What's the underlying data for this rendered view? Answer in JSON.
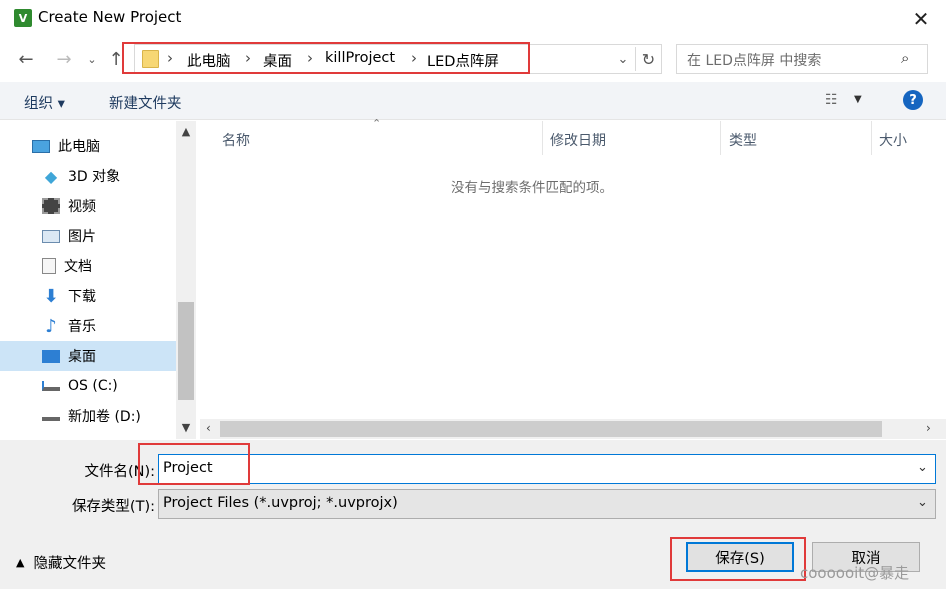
{
  "window": {
    "title": "Create New Project",
    "app_icon_glyph": "V",
    "close_glyph": "✕"
  },
  "nav": {
    "breadcrumbs": [
      "此电脑",
      "桌面",
      "killProject",
      "LED点阵屏"
    ],
    "search_placeholder": "在 LED点阵屏 中搜索"
  },
  "toolbar": {
    "organize": "组织 ▾",
    "new_folder": "新建文件夹",
    "help": "?"
  },
  "sidebar": {
    "items": [
      {
        "label": "此电脑",
        "icon": "computer-icon"
      },
      {
        "label": "3D 对象",
        "icon": "cube-icon"
      },
      {
        "label": "视频",
        "icon": "film-icon"
      },
      {
        "label": "图片",
        "icon": "picture-icon"
      },
      {
        "label": "文档",
        "icon": "document-icon"
      },
      {
        "label": "下载",
        "icon": "download-arrow-icon"
      },
      {
        "label": "音乐",
        "icon": "music-note-icon"
      },
      {
        "label": "桌面",
        "icon": "desktop-icon",
        "selected": true
      },
      {
        "label": "OS (C:)",
        "icon": "drive-icon"
      },
      {
        "label": "新加卷 (D:)",
        "icon": "drive-icon"
      }
    ]
  },
  "file_list": {
    "columns": [
      "名称",
      "修改日期",
      "类型",
      "大小"
    ],
    "empty_message": "没有与搜索条件匹配的项。"
  },
  "form": {
    "filename_label": "文件名(N):",
    "filename_value": "Project",
    "filetype_label": "保存类型(T):",
    "filetype_value": "Project Files (*.uvproj; *.uvprojx)"
  },
  "footer": {
    "hide_folders": "隐藏文件夹",
    "save": "保存(S)",
    "cancel": "取消",
    "watermark": "coooooit@暴走"
  },
  "colors": {
    "accent": "#0078d7",
    "highlight": "#e03a3a",
    "selected": "#cce4f7"
  }
}
